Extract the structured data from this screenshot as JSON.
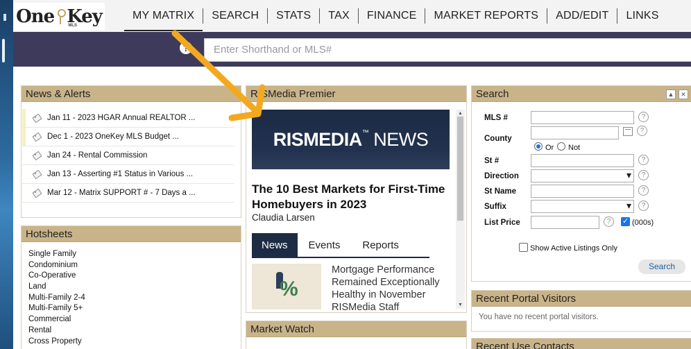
{
  "logo": {
    "text_one": "One",
    "text_key": "Key",
    "mls": "MLS"
  },
  "nav": [
    {
      "label": "MY MATRIX"
    },
    {
      "label": "SEARCH"
    },
    {
      "label": "STATS"
    },
    {
      "label": "TAX"
    },
    {
      "label": "FINANCE"
    },
    {
      "label": "MARKET REPORTS"
    },
    {
      "label": "ADD/EDIT"
    },
    {
      "label": "LINKS"
    }
  ],
  "shorthand": {
    "placeholder": "Enter Shorthand or MLS#",
    "help_icon": "help-circle-icon"
  },
  "news_alerts": {
    "title": "News & Alerts",
    "items": [
      "Jan 11 - 2023 HGAR Annual REALTOR ...",
      "Dec 1 - 2023 OneKey MLS Budget ...",
      "Jan 24 - Rental Commission",
      "Jan 13 - Asserting #1 Status in Various ...",
      "Mar 12 - Matrix SUPPORT # - 7 Days a ..."
    ]
  },
  "hotsheets": {
    "title": "Hotsheets",
    "items": [
      "Single Family",
      "Condominium",
      "Co-Operative",
      "Land",
      "Multi-Family 2-4",
      "Multi-Family 5+",
      "Commercial",
      "Rental",
      "Cross Property"
    ]
  },
  "rismedia": {
    "title": "RISMedia Premier",
    "banner_bold": "RISMEDIA",
    "banner_light": "NEWS",
    "headline": "The 10 Best Markets for First-Time Homebuyers in 2023",
    "author": "Claudia Larsen",
    "tabs": [
      "News",
      "Events",
      "Reports"
    ],
    "article": "Mortgage Performance Remained Exceptionally Healthy in November RISMedia Staff"
  },
  "market_watch": {
    "title": "Market Watch"
  },
  "search": {
    "title": "Search",
    "mls_label": "MLS #",
    "county_label": "County",
    "or_label": "Or",
    "not_label": "Not",
    "st_num_label": "St #",
    "direction_label": "Direction",
    "st_name_label": "St Name",
    "suffix_label": "Suffix",
    "list_price_label": "List Price",
    "thousands_label": "(000s)",
    "active_only_label": "Show Active Listings Only",
    "button": "Search"
  },
  "recent_visitors": {
    "title": "Recent Portal Visitors",
    "empty": "You have no recent portal visitors."
  },
  "recent_contacts": {
    "title": "Recent Use Contacts"
  },
  "colors": {
    "panel_header": "#c9b48a",
    "nav_dark": "#3d3a5c",
    "ris_navy": "#1d2b44",
    "arrow": "#f3a91f"
  }
}
